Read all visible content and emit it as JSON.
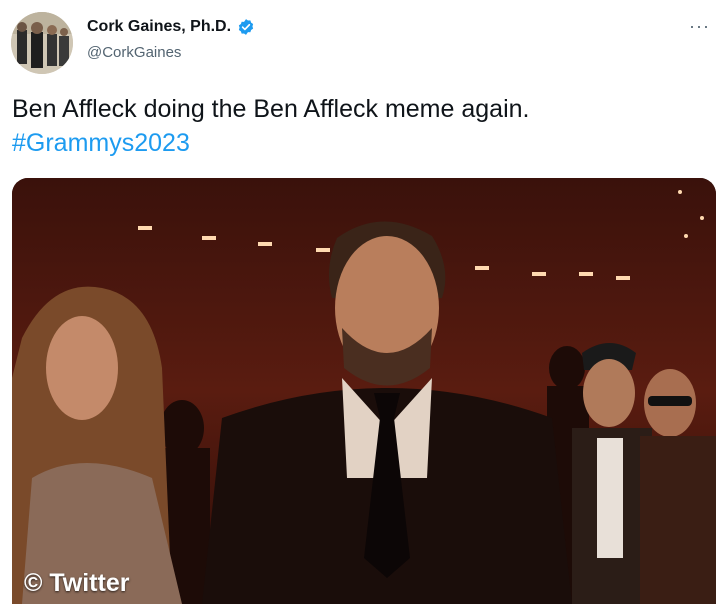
{
  "author": {
    "display_name": "Cork Gaines, Ph.D.",
    "handle": "@CorkGaines",
    "verified_icon": "verified-badge-icon",
    "avatar_icon": "avatar-photo"
  },
  "menu": {
    "label": "···"
  },
  "tweet": {
    "text": "Ben Affleck doing the Ben Affleck meme again.",
    "hashtag": "#Grammys2023"
  },
  "media": {
    "watermark": "© Twitter",
    "description_icon": "embedded-video-frame"
  },
  "colors": {
    "link": "#1d9bf0",
    "secondary_text": "#536471",
    "verified": "#1d9bf0"
  }
}
